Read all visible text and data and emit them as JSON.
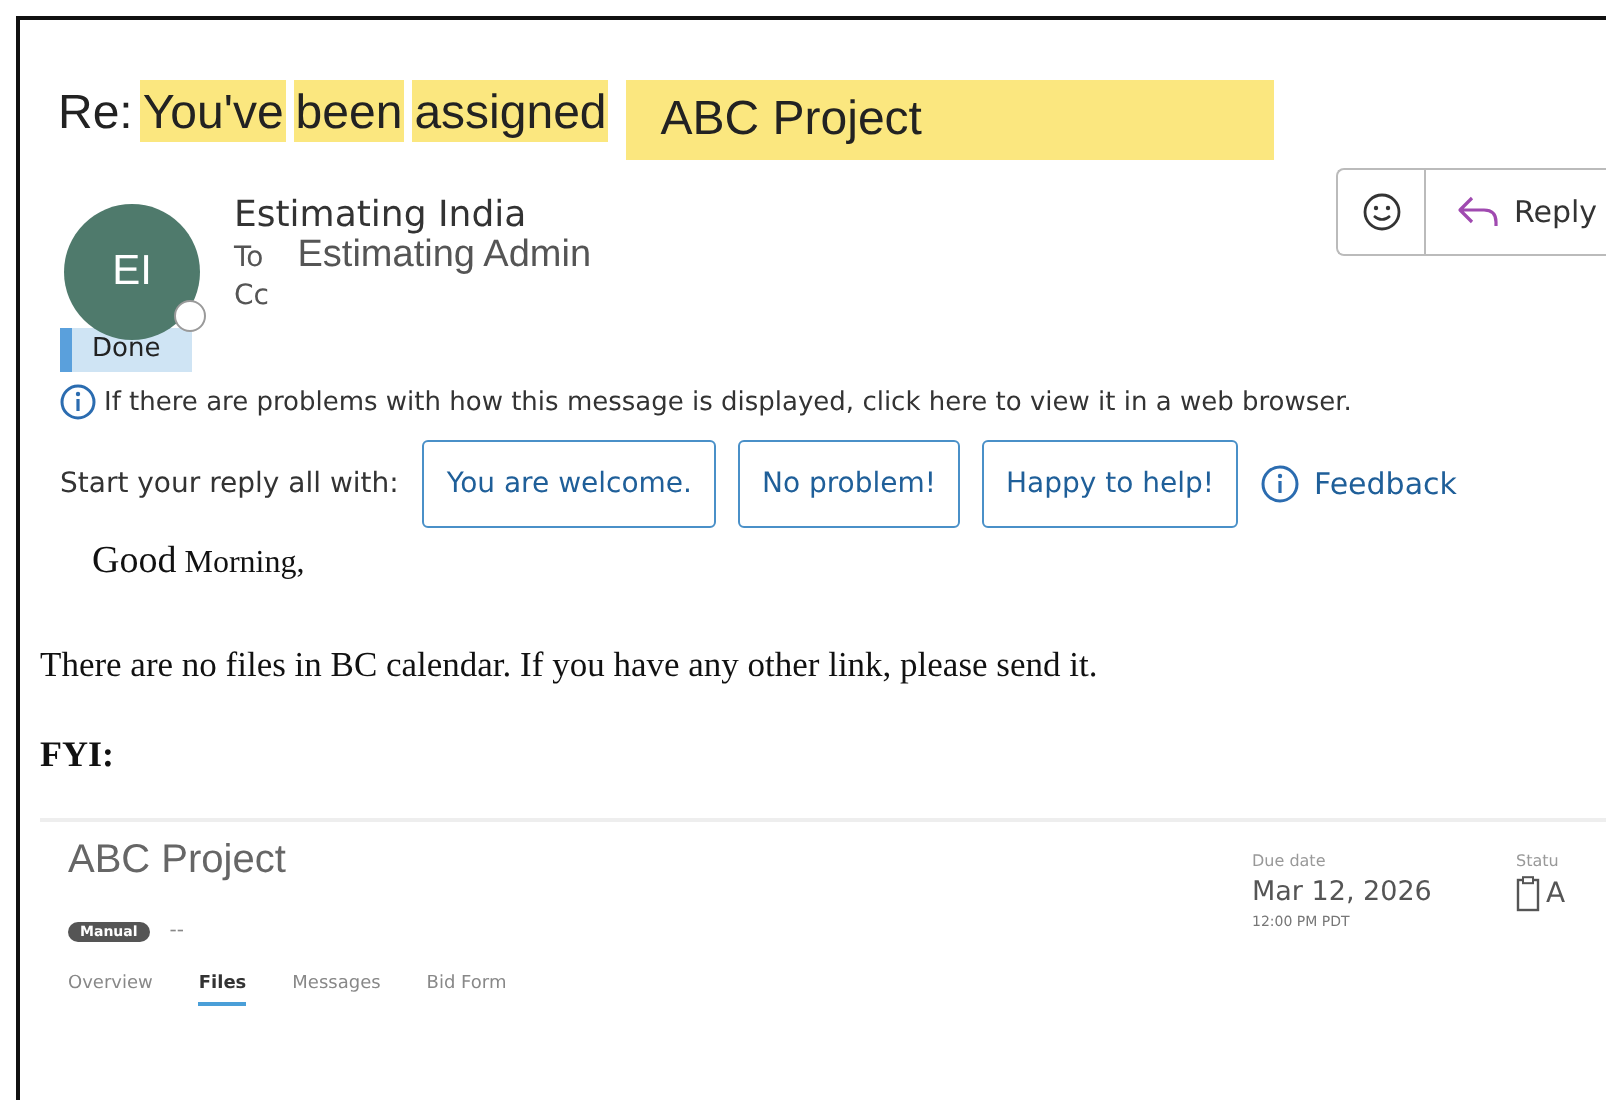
{
  "subject": {
    "prefix": "Re:",
    "parts": [
      {
        "text": "You've",
        "highlighted": true
      },
      {
        "text": "been",
        "highlighted": true
      },
      {
        "text": "assigned",
        "highlighted": true
      },
      {
        "text": "ABC Project",
        "highlighted": true,
        "kind": "block"
      }
    ]
  },
  "sender": {
    "initials": "EI",
    "name": "Estimating India",
    "to_label": "To",
    "to": "Estimating Admin",
    "cc_label": "Cc"
  },
  "actions": {
    "reply": "Reply"
  },
  "category": {
    "label": "Done",
    "color": "#5aa0dc"
  },
  "info": "If there are problems with how this message is displayed, click here to view it in a web browser.",
  "suggestions": {
    "label": "Start your reply all with:",
    "items": [
      "You are welcome.",
      "No problem!",
      "Happy to help!"
    ],
    "feedback": "Feedback"
  },
  "body": {
    "greeting": [
      {
        "text": "Good",
        "kind": "large"
      },
      {
        "text": "Morning,",
        "kind": "small"
      }
    ],
    "paragraph": "There are no files in BC calendar. If you have any other link, please send it.",
    "fyi": "FYI:"
  },
  "card": {
    "title": "ABC Project",
    "tag": "Manual",
    "tag_note": "--",
    "due_label": "Due date",
    "due_date": "Mar 12, 2026",
    "due_time": "12:00 PM PDT",
    "status_label": "Statu",
    "status_value": "A",
    "tabs": [
      {
        "label": "Overview",
        "selected": false
      },
      {
        "label": "Files",
        "selected": true
      },
      {
        "label": "Messages",
        "selected": false
      },
      {
        "label": "Bid Form",
        "selected": false
      }
    ]
  }
}
